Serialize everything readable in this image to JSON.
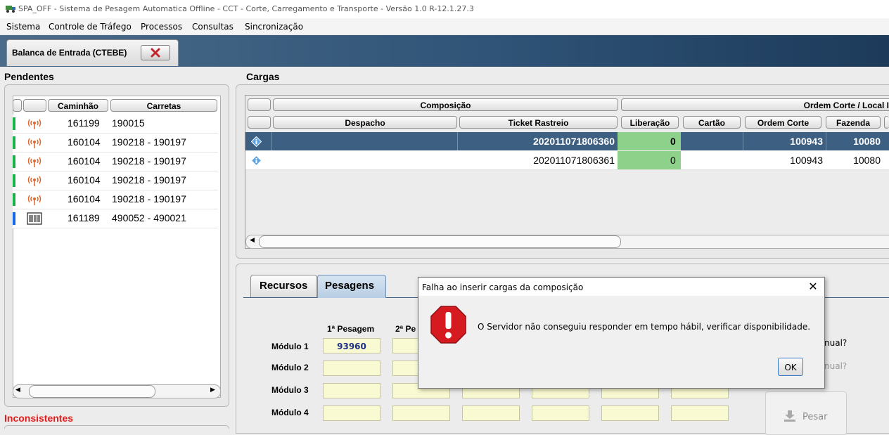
{
  "window": {
    "title": "SPA_OFF - Sistema de Pesagem Automatica Offline - CCT - Corte, Carregamento e Transporte - Versão 1.0 R-12.1.27.3"
  },
  "menu": [
    "Sistema",
    "Controle de Tráfego",
    "Processos",
    "Consultas",
    "Sincronização"
  ],
  "doc_tab": {
    "label": "Balanca de Entrada (CTEBE)"
  },
  "pendentes": {
    "title": "Pendentes",
    "headers": [
      "Caminhão",
      "Carretas"
    ],
    "rows": [
      {
        "camiao": "161199",
        "carretas": "190015",
        "icon": "antenna-icon",
        "status_color": "#1ab04a"
      },
      {
        "camiao": "160104",
        "carretas": "190218 - 190197",
        "icon": "antenna-icon",
        "status_color": "#1ab04a"
      },
      {
        "camiao": "160104",
        "carretas": "190218 - 190197",
        "icon": "antenna-icon",
        "status_color": "#1ab04a"
      },
      {
        "camiao": "160104",
        "carretas": "190218 - 190197",
        "icon": "antenna-icon",
        "status_color": "#1ab04a"
      },
      {
        "camiao": "160104",
        "carretas": "190218 - 190197",
        "icon": "antenna-icon",
        "status_color": "#1ab04a"
      },
      {
        "camiao": "161189",
        "carretas": "490052 - 490021",
        "icon": "barcode-icon",
        "status_color": "#1766e6"
      }
    ]
  },
  "inconsistentes": {
    "title": "Inconsistentes"
  },
  "cargas": {
    "title": "Cargas",
    "group_headers": [
      "Composição",
      "Ordem Corte / Local I"
    ],
    "headers": [
      "Despacho",
      "Ticket Rastreio",
      "Liberação",
      "Cartão",
      "Ordem Corte",
      "Fazenda"
    ],
    "rows": [
      {
        "despacho": "",
        "ticket": "202011071806360",
        "liberacao": "0",
        "cartao": "",
        "ordem_corte": "100943",
        "fazenda": "10080",
        "selected": true
      },
      {
        "despacho": "",
        "ticket": "202011071806361",
        "liberacao": "0",
        "cartao": "",
        "ordem_corte": "100943",
        "fazenda": "10080",
        "selected": false
      }
    ]
  },
  "subtabs": {
    "recursos": "Recursos",
    "pesagens": "Pesagens"
  },
  "pesagens": {
    "col1_header": "1ª Pesagem",
    "col2_header": "2ª Pe",
    "modules": [
      "Módulo 1",
      "Módulo 2",
      "Módulo 3",
      "Módulo 4"
    ],
    "modulo1_primeira": "93960",
    "side_label_1": "nual?",
    "side_label_2": "nual?",
    "pesar_button": "Pesar"
  },
  "dialog": {
    "title": "Falha ao inserir cargas da composição",
    "message": "O Servidor não conseguiu responder em tempo hábil, verificar disponibilidade.",
    "ok_label": "OK"
  },
  "colors": {
    "accent_blue": "#2f5477",
    "selected_row": "#3d5f82",
    "liberacao_green": "#8ed18a",
    "weight_field": "#fafad2",
    "error_red": "#d51b20",
    "inconsistent_red": "#e31b1b"
  }
}
